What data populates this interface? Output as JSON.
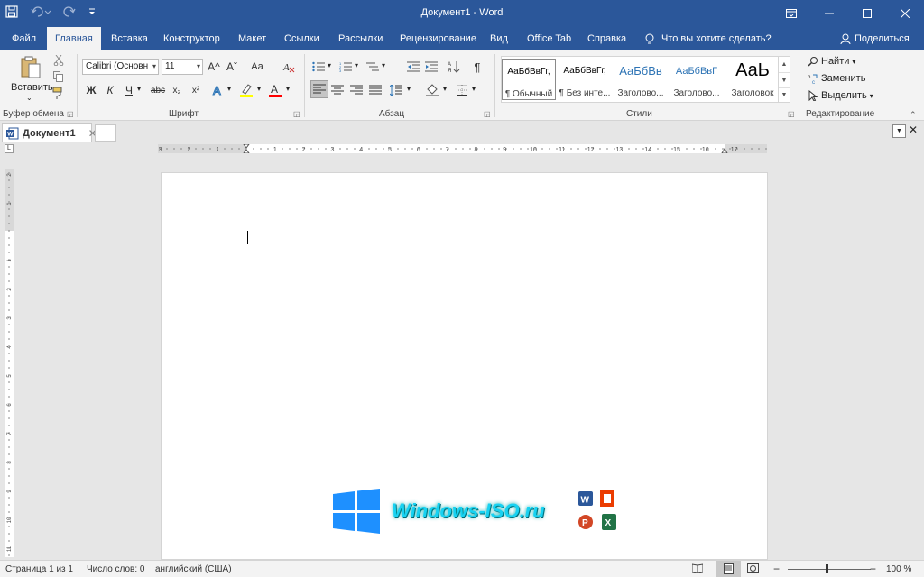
{
  "window": {
    "title": "Документ1  -  Word"
  },
  "tabs": [
    {
      "label": "Файл"
    },
    {
      "label": "Главная"
    },
    {
      "label": "Вставка"
    },
    {
      "label": "Конструктор"
    },
    {
      "label": "Макет"
    },
    {
      "label": "Ссылки"
    },
    {
      "label": "Рассылки"
    },
    {
      "label": "Рецензирование"
    },
    {
      "label": "Вид"
    },
    {
      "label": "Office Tab"
    },
    {
      "label": "Справка"
    }
  ],
  "tell_me": "Что вы хотите сделать?",
  "share": "Поделиться",
  "clipboard": {
    "paste_label": "Вставить",
    "group_label": "Буфер обмена"
  },
  "font": {
    "name": "Calibri (Основн",
    "size": "11",
    "group_label": "Шрифт",
    "bold": "Ж",
    "italic": "К",
    "underline": "Ч",
    "strike": "abc",
    "sub": "x₂",
    "sup": "x²",
    "grow": "A^",
    "shrink": "Aˇ",
    "case": "Aa"
  },
  "paragraph": {
    "group_label": "Абзац"
  },
  "styles": {
    "group_label": "Стили",
    "items": [
      {
        "preview": "АаБбВвГг,",
        "name": "¶ Обычный"
      },
      {
        "preview": "АаБбВвГг,",
        "name": "¶ Без инте..."
      },
      {
        "preview": "АаБбВв",
        "name": "Заголово..."
      },
      {
        "preview": "АаБбВвГ",
        "name": "Заголово..."
      },
      {
        "preview": "АаЬ",
        "name": "Заголовок"
      }
    ]
  },
  "editing": {
    "group_label": "Редактирование",
    "find": "Найти",
    "replace": "Заменить",
    "select": "Выделить"
  },
  "doc_tab": {
    "title": "Документ1"
  },
  "ruler": {
    "labels": [
      "3",
      "2",
      "1",
      "1",
      "2",
      "3",
      "4",
      "5",
      "6",
      "7",
      "8",
      "9",
      "10",
      "11",
      "12",
      "13",
      "14",
      "15",
      "16",
      "17"
    ]
  },
  "ruler_v": {
    "labels": [
      "2",
      "1",
      "1",
      "2",
      "3",
      "4",
      "5",
      "6",
      "7",
      "8",
      "9",
      "10",
      "11",
      "12"
    ]
  },
  "watermark": {
    "text": "Windows-ISO.ru"
  },
  "status": {
    "page": "Страница 1 из 1",
    "words": "Число слов: 0",
    "lang": "английский (США)",
    "zoom": "100 %"
  },
  "colors": {
    "brand": "#2b579a",
    "ribbon": "#f3f3f3",
    "highlight": "#ffff00",
    "font_color": "#ff0000"
  }
}
